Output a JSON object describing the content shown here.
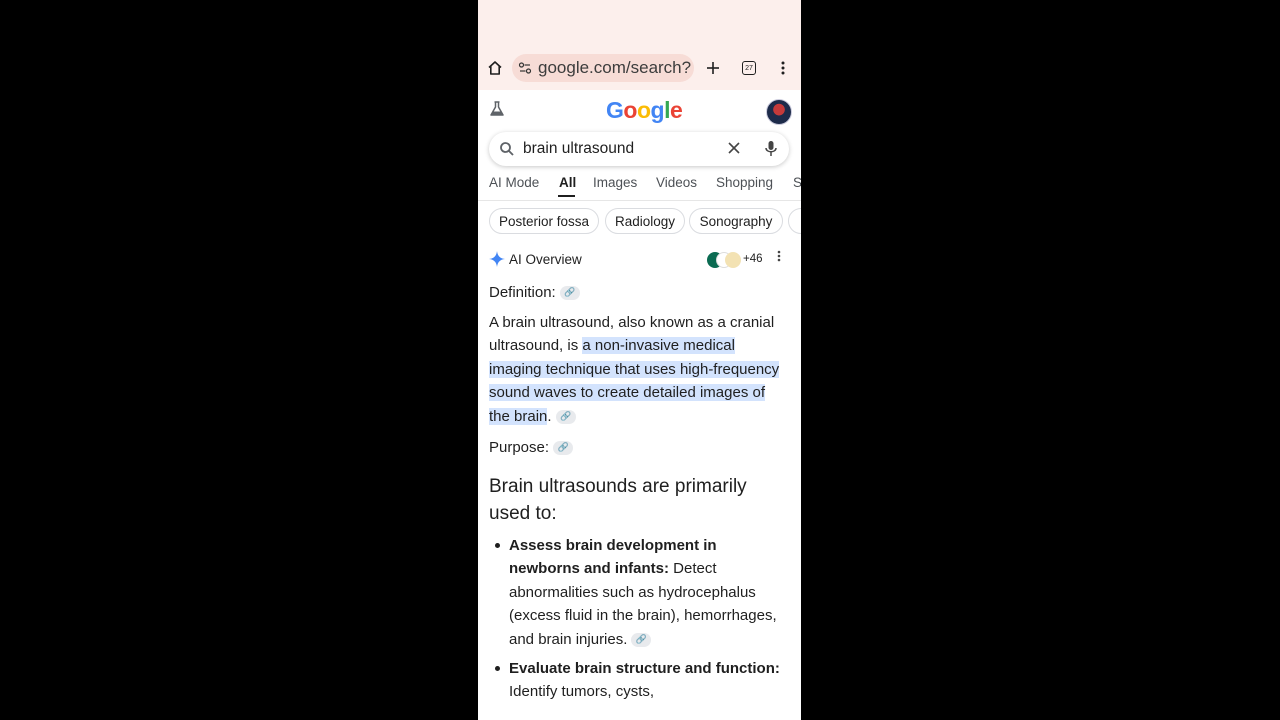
{
  "browser": {
    "url": "google.com/search?",
    "tab_count": "27"
  },
  "search": {
    "query": "brain ultrasound",
    "logo_letters": [
      "G",
      "o",
      "o",
      "g",
      "l",
      "e"
    ],
    "logo_colors": [
      "#4285F4",
      "#EA4335",
      "#FBBC05",
      "#4285F4",
      "#34A853",
      "#EA4335"
    ]
  },
  "nav_tabs": [
    "AI Mode",
    "All",
    "Images",
    "Videos",
    "Shopping",
    "S"
  ],
  "active_tab": "All",
  "chips": [
    "Posterior fossa",
    "Radiology",
    "Sonography"
  ],
  "ai_overview": {
    "title": "AI Overview",
    "sources_more": "+46",
    "definition_label": "Definition:",
    "definition_plain": "A brain ultrasound, also known as a cranial ultrasound, is ",
    "definition_highlight": "a non-invasive medical imaging technique that uses high-frequency sound waves to create detailed images of the brain",
    "definition_end": ".",
    "purpose_label": "Purpose:",
    "heading": "Brain ultrasounds are primarily used to:",
    "bullets": [
      {
        "bold": "Assess brain development in newborns and infants:",
        "text": " Detect abnormalities such as hydrocephalus (excess fluid in the brain), hemorrhages, and brain injuries."
      },
      {
        "bold": "Evaluate brain structure and function:",
        "text": " Identify tumors, cysts,"
      }
    ]
  },
  "colors": {
    "status_bar": "#fcefec",
    "url_pill": "#f7dcd6",
    "highlight": "#d3e3fd",
    "link_chip": "#e8eaed"
  }
}
